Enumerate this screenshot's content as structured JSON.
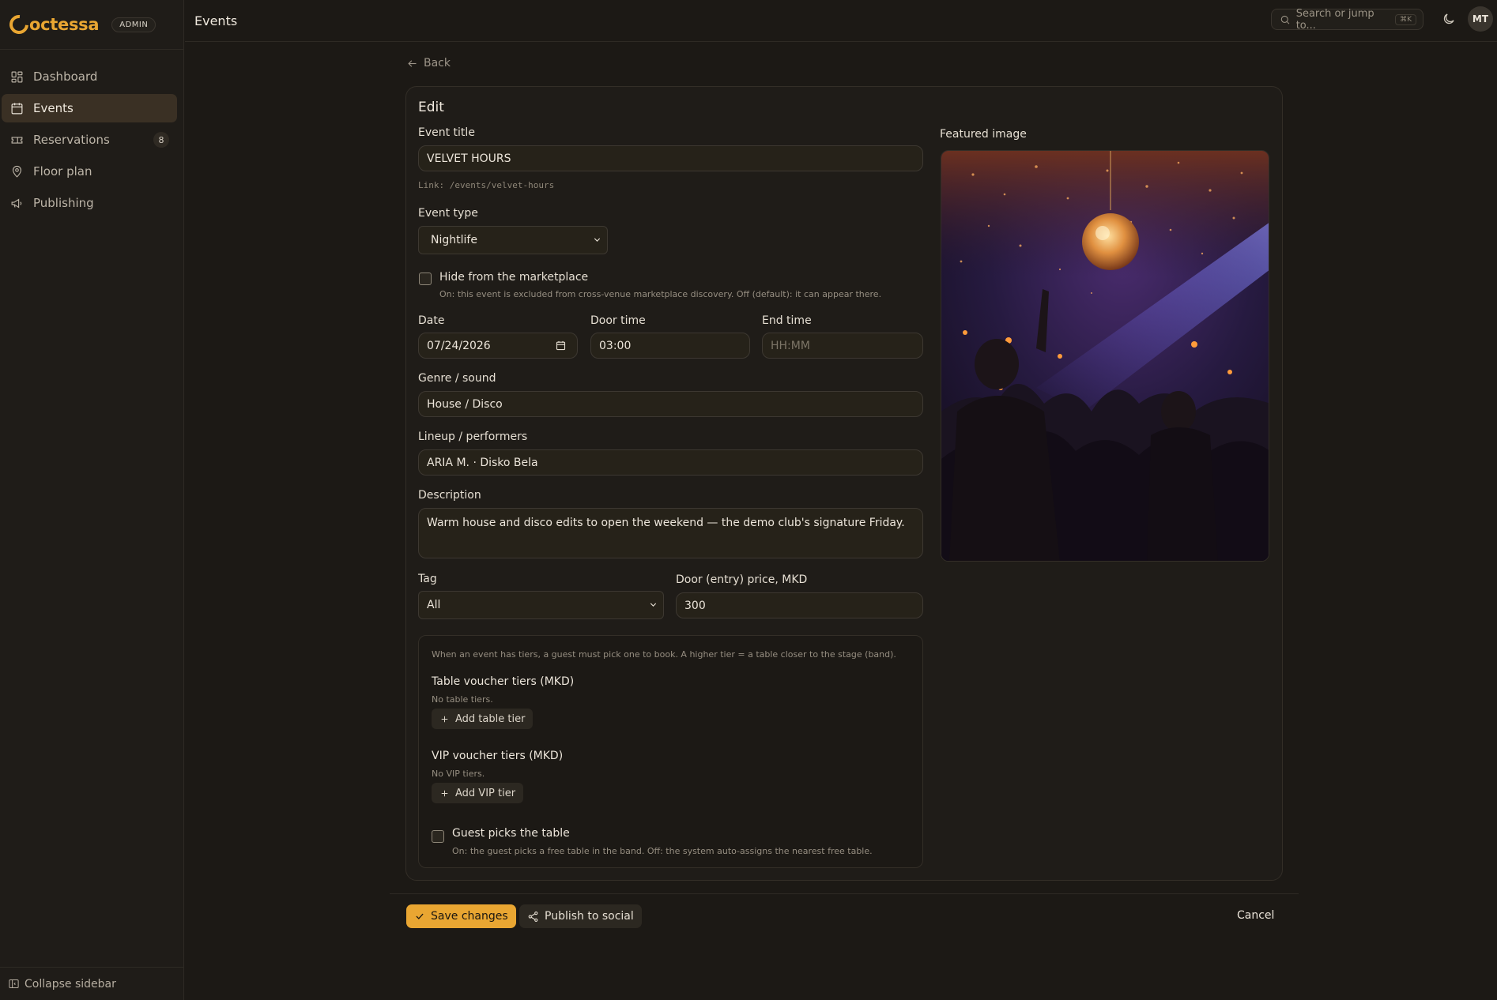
{
  "brand": {
    "name": "Noctessa",
    "name_rest": "octessa",
    "badge": "ADMIN",
    "accent": "#e9a632"
  },
  "sidebar": {
    "items": [
      {
        "label": "Dashboard",
        "icon": "dashboard-icon"
      },
      {
        "label": "Events",
        "icon": "calendar-icon",
        "active": true
      },
      {
        "label": "Reservations",
        "icon": "ticket-icon",
        "count": "8"
      },
      {
        "label": "Floor plan",
        "icon": "map-pin-icon"
      },
      {
        "label": "Publishing",
        "icon": "megaphone-icon"
      }
    ],
    "collapse_label": "Collapse sidebar"
  },
  "topbar": {
    "title": "Events",
    "search_placeholder": "Search or jump to...",
    "search_shortcut": "⌘K",
    "avatar_initials": "MT"
  },
  "back_label": "Back",
  "form": {
    "card_title": "Edit",
    "event_title_label": "Event title",
    "event_title_value": "VELVET HOURS",
    "link_text": "Link: /events/velvet-hours",
    "event_type_label": "Event type",
    "event_type_value": "Nightlife",
    "hide_marketplace_label": "Hide from the marketplace",
    "hide_marketplace_hint": "On: this event is excluded from cross-venue marketplace discovery. Off (default): it can appear there.",
    "date_label": "Date",
    "date_value": "07/24/2026",
    "door_time_label": "Door time",
    "door_time_value": "03:00",
    "end_time_label": "End time",
    "end_time_placeholder": "HH:MM",
    "genre_label": "Genre / sound",
    "genre_value": "House / Disco",
    "lineup_label": "Lineup / performers",
    "lineup_value": "ARIA M. · Disko Bela",
    "description_label": "Description",
    "description_value": "Warm house and disco edits to open the weekend — the demo club's signature Friday.",
    "tag_label": "Tag",
    "tag_value": "All",
    "door_price_label": "Door (entry) price, MKD",
    "door_price_value": "300"
  },
  "tiers": {
    "intro": "When an event has tiers, a guest must pick one to book. A higher tier = a table closer to the stage (band).",
    "table_heading": "Table voucher tiers (MKD)",
    "table_empty": "No table tiers.",
    "add_table_label": "Add table tier",
    "vip_heading": "VIP voucher tiers (MKD)",
    "vip_empty": "No VIP tiers.",
    "add_vip_label": "Add VIP tier",
    "guest_picks_label": "Guest picks the table",
    "guest_picks_hint": "On: the guest picks a free table in the band. Off: the system auto-assigns the nearest free table."
  },
  "featured": {
    "label": "Featured image"
  },
  "actions": {
    "save_label": "Save changes",
    "publish_label": "Publish to social",
    "cancel_label": "Cancel"
  }
}
